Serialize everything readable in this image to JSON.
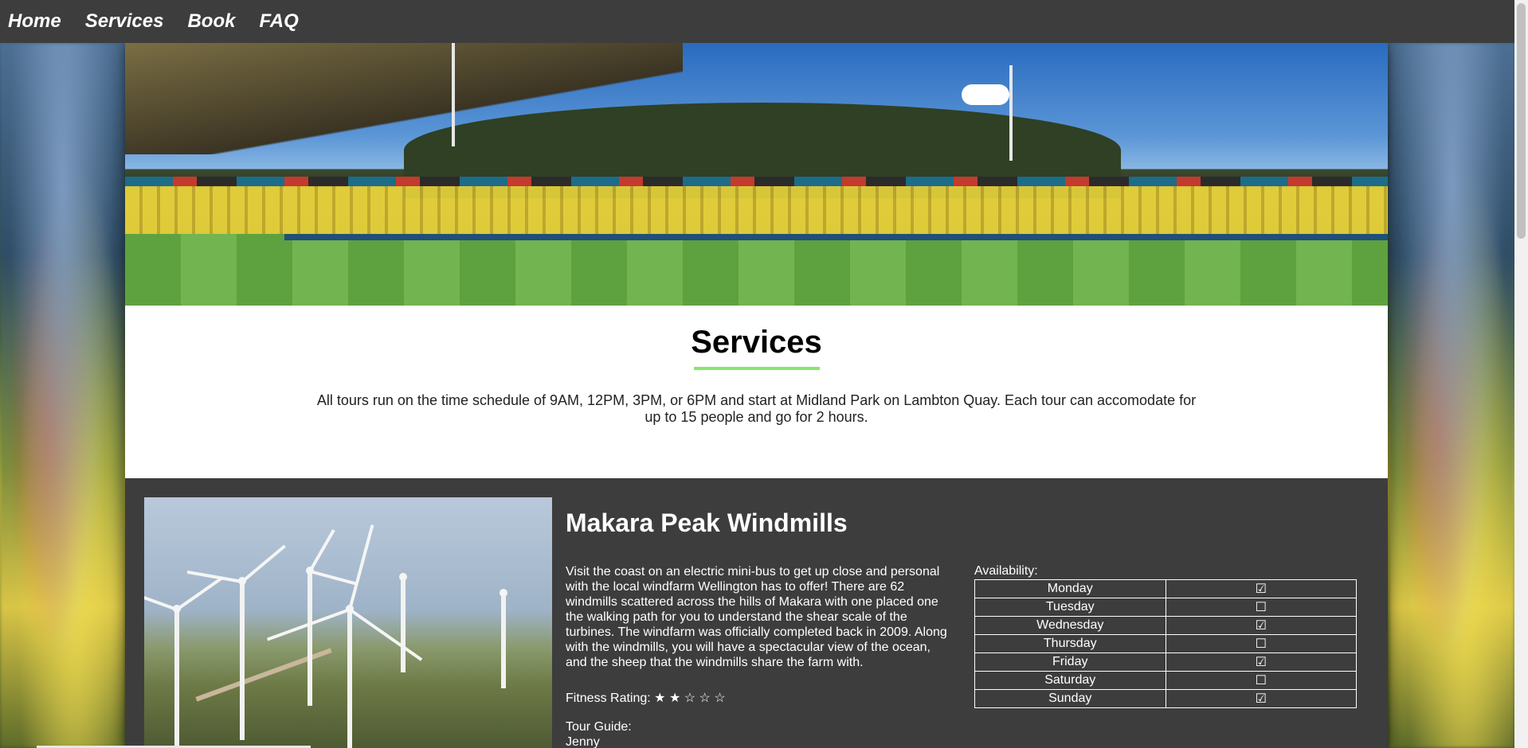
{
  "nav": {
    "items": [
      {
        "label": "Home"
      },
      {
        "label": "Services"
      },
      {
        "label": "Book"
      },
      {
        "label": "FAQ"
      }
    ]
  },
  "intro": {
    "title": "Services",
    "text": "All tours run on the time schedule of 9AM, 12PM, 3PM, or 6PM and start at Midland Park on Lambton Quay. Each tour can accomodate for up to 15 people and go for 2 hours."
  },
  "tour": {
    "title": "Makara Peak Windmills",
    "description": "Visit the coast on an electric mini-bus to get up close and personal with the local windfarm Wellington has to offer! There are 62 windmills scattered across the hills of Makara with one placed one the walking path for you to understand the shear scale of the turbines. The windfarm was officially completed back in 2009. Along with the windmills, you will have a spectacular view of the ocean, and the sheep that the windmills share the farm with.",
    "fitness": "Fitness Rating: ★ ★ ☆ ☆ ☆",
    "guide_label": "Tour Guide:",
    "guide_name": "Jenny",
    "availability_label": "Availability:",
    "availability": [
      {
        "day": "Monday",
        "mark": "☑"
      },
      {
        "day": "Tuesday",
        "mark": "☐"
      },
      {
        "day": "Wednesday",
        "mark": "☑"
      },
      {
        "day": "Thursday",
        "mark": "☐"
      },
      {
        "day": "Friday",
        "mark": "☑"
      },
      {
        "day": "Saturday",
        "mark": "☐"
      },
      {
        "day": "Sunday",
        "mark": "☑"
      }
    ]
  },
  "colors": {
    "nav_bg": "#3d3d3d",
    "accent_underline": "#86e86b",
    "tour_bg": "#3d3d3d"
  }
}
